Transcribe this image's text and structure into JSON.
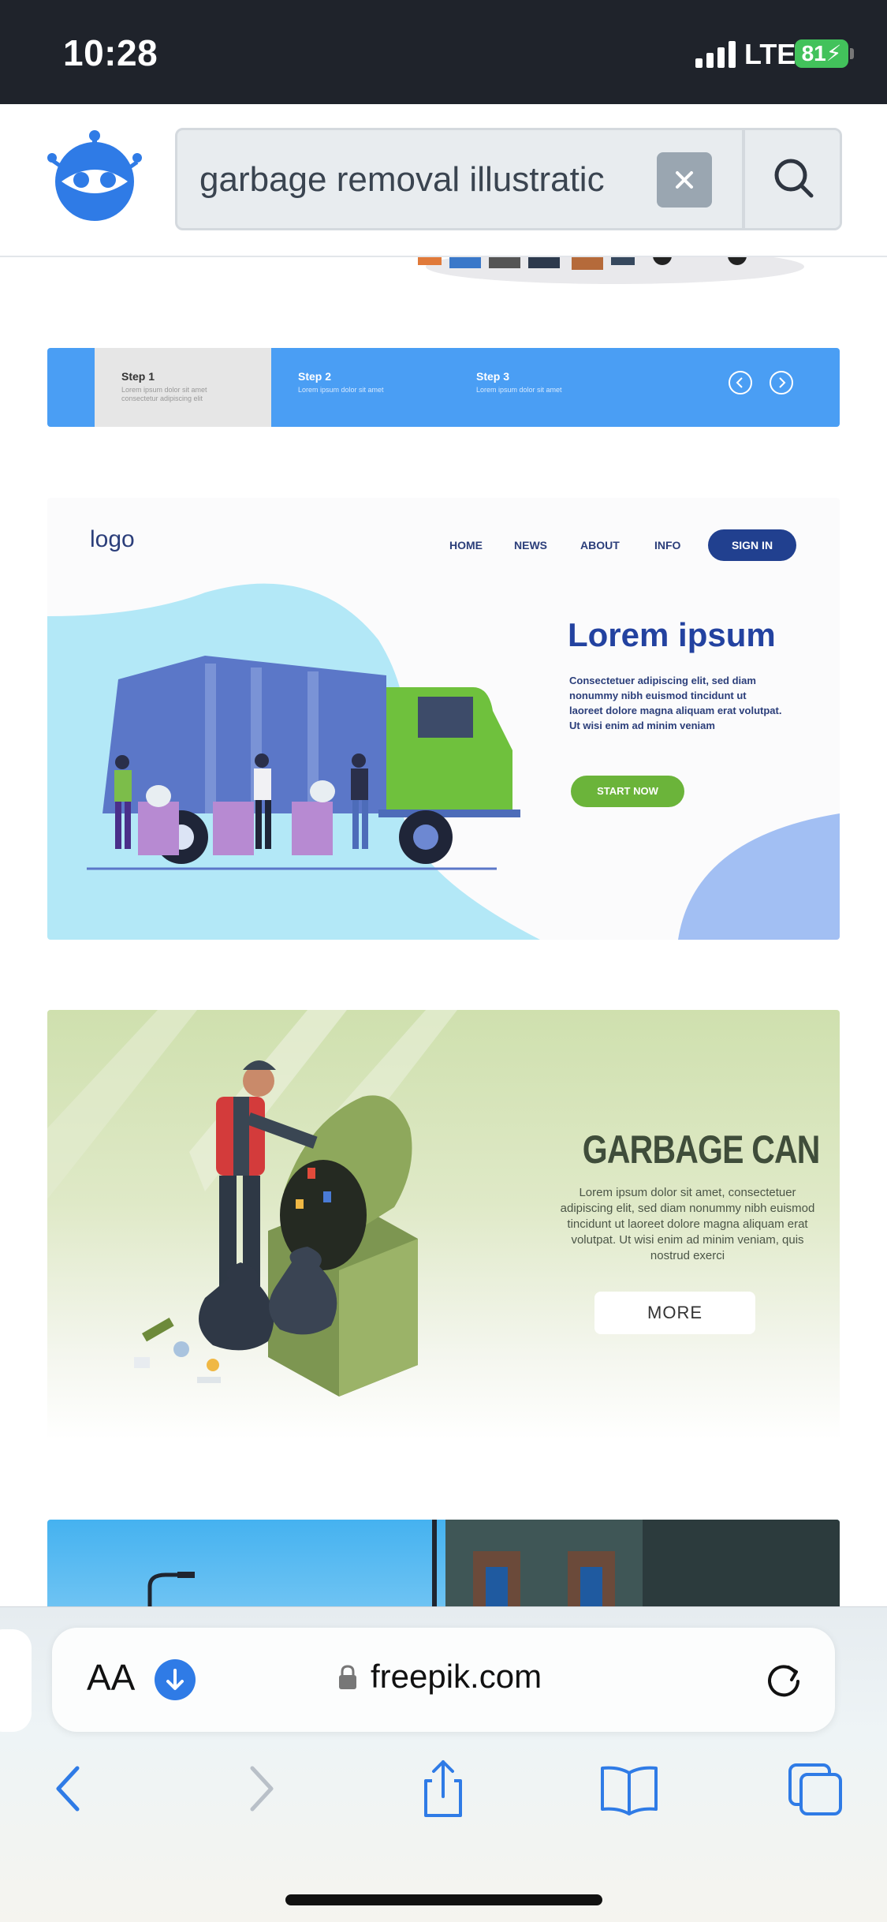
{
  "status_bar": {
    "time": "10:28",
    "network": "LTE",
    "battery": "81"
  },
  "search": {
    "query": "garbage removal illustratic"
  },
  "steps_banner": {
    "steps": [
      {
        "title": "Step 1",
        "desc": "Lorem ipsum dolor sit amet consectetur adipiscing elit"
      },
      {
        "title": "Step 2",
        "desc": "Lorem ipsum dolor sit amet"
      },
      {
        "title": "Step 3",
        "desc": "Lorem ipsum dolor sit amet"
      }
    ]
  },
  "landing": {
    "logo": "logo",
    "nav": [
      "HOME",
      "NEWS",
      "ABOUT",
      "INFO"
    ],
    "signin": "SIGN IN",
    "title": "Lorem ipsum",
    "body": "Consectetuer adipiscing elit, sed diam nonummy nibh euismod tincidunt ut laoreet dolore magna aliquam erat volutpat. Ut wisi enim ad minim veniam",
    "cta": "START NOW"
  },
  "garbage_card": {
    "title": "GARBAGE CAN",
    "body": "Lorem ipsum dolor sit amet, consectetuer adipiscing elit, sed diam nonummy nibh euismod tincidunt ut laoreet dolore magna aliquam erat volutpat. Ut wisi enim ad minim veniam, quis nostrud exerci",
    "button": "MORE"
  },
  "browser": {
    "text_size": "AA",
    "domain": "freepik.com"
  },
  "colors": {
    "accent": "#3f7ee8",
    "steps_blue": "#4a9ef4",
    "landing_navy": "#2342a0",
    "cta_green": "#6bb43a"
  }
}
